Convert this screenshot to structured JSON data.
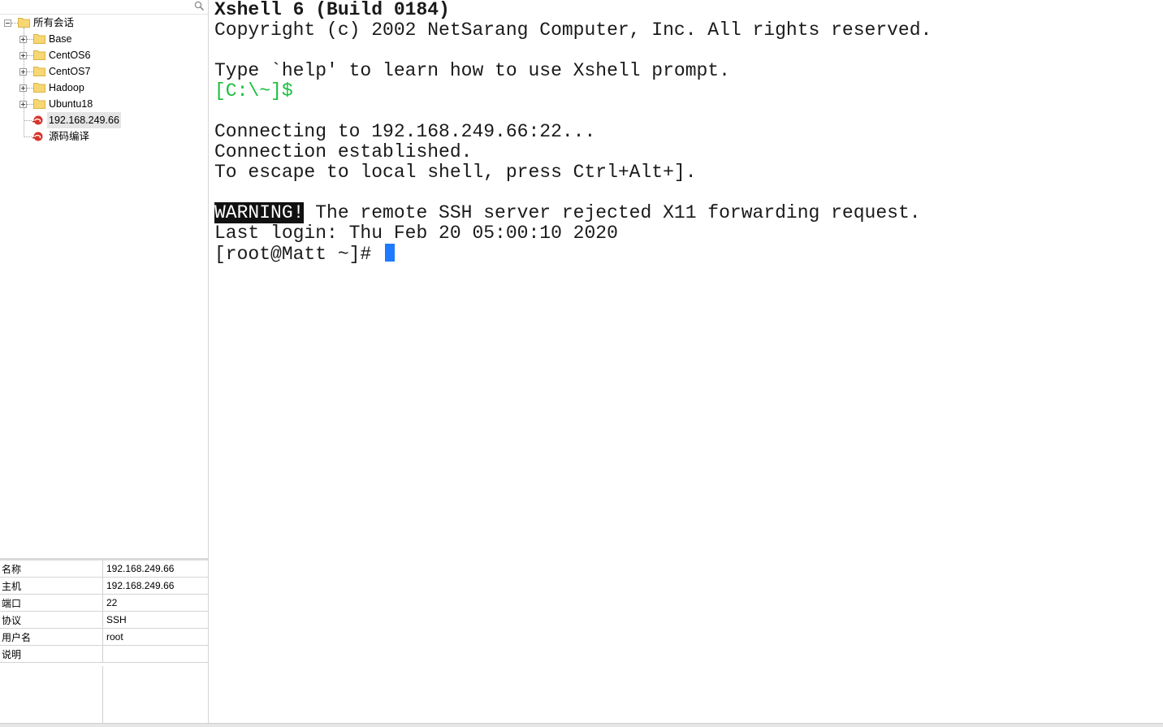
{
  "search": {
    "placeholder": "",
    "icon": "search-icon"
  },
  "tree": {
    "root": {
      "label": "所有会话",
      "expanded": true
    },
    "folders": [
      {
        "label": "Base"
      },
      {
        "label": "CentOS6"
      },
      {
        "label": "CentOS7"
      },
      {
        "label": "Hadoop"
      },
      {
        "label": "Ubuntu18"
      }
    ],
    "sessions": [
      {
        "label": "192.168.249.66",
        "selected": true
      },
      {
        "label": "源码编译",
        "selected": false
      }
    ]
  },
  "properties": [
    {
      "key": "名称",
      "value": "192.168.249.66"
    },
    {
      "key": "主机",
      "value": "192.168.249.66"
    },
    {
      "key": "端口",
      "value": "22"
    },
    {
      "key": "协议",
      "value": "SSH"
    },
    {
      "key": "用户名",
      "value": "root"
    },
    {
      "key": "说明",
      "value": ""
    }
  ],
  "terminal": {
    "banner_title": "Xshell 6 (Build 0184)",
    "copyright": "Copyright (c) 2002 NetSarang Computer, Inc. All rights reserved.",
    "help_hint": "Type `help' to learn how to use Xshell prompt.",
    "local_prompt": "[C:\\~]$",
    "connecting": "Connecting to 192.168.249.66:22...",
    "established": "Connection established.",
    "escape_hint": "To escape to local shell, press Ctrl+Alt+].",
    "warning_tag": "WARNING!",
    "warning_text": " The remote SSH server rejected X11 forwarding request.",
    "last_login": "Last login: Thu Feb 20 05:00:10 2020",
    "remote_prompt": "[root@Matt ~]# "
  },
  "colors": {
    "prompt_green": "#19bf3d",
    "cursor_blue": "#1e7aff",
    "folder_yellow": "#f7d774",
    "session_red": "#d9342b"
  }
}
